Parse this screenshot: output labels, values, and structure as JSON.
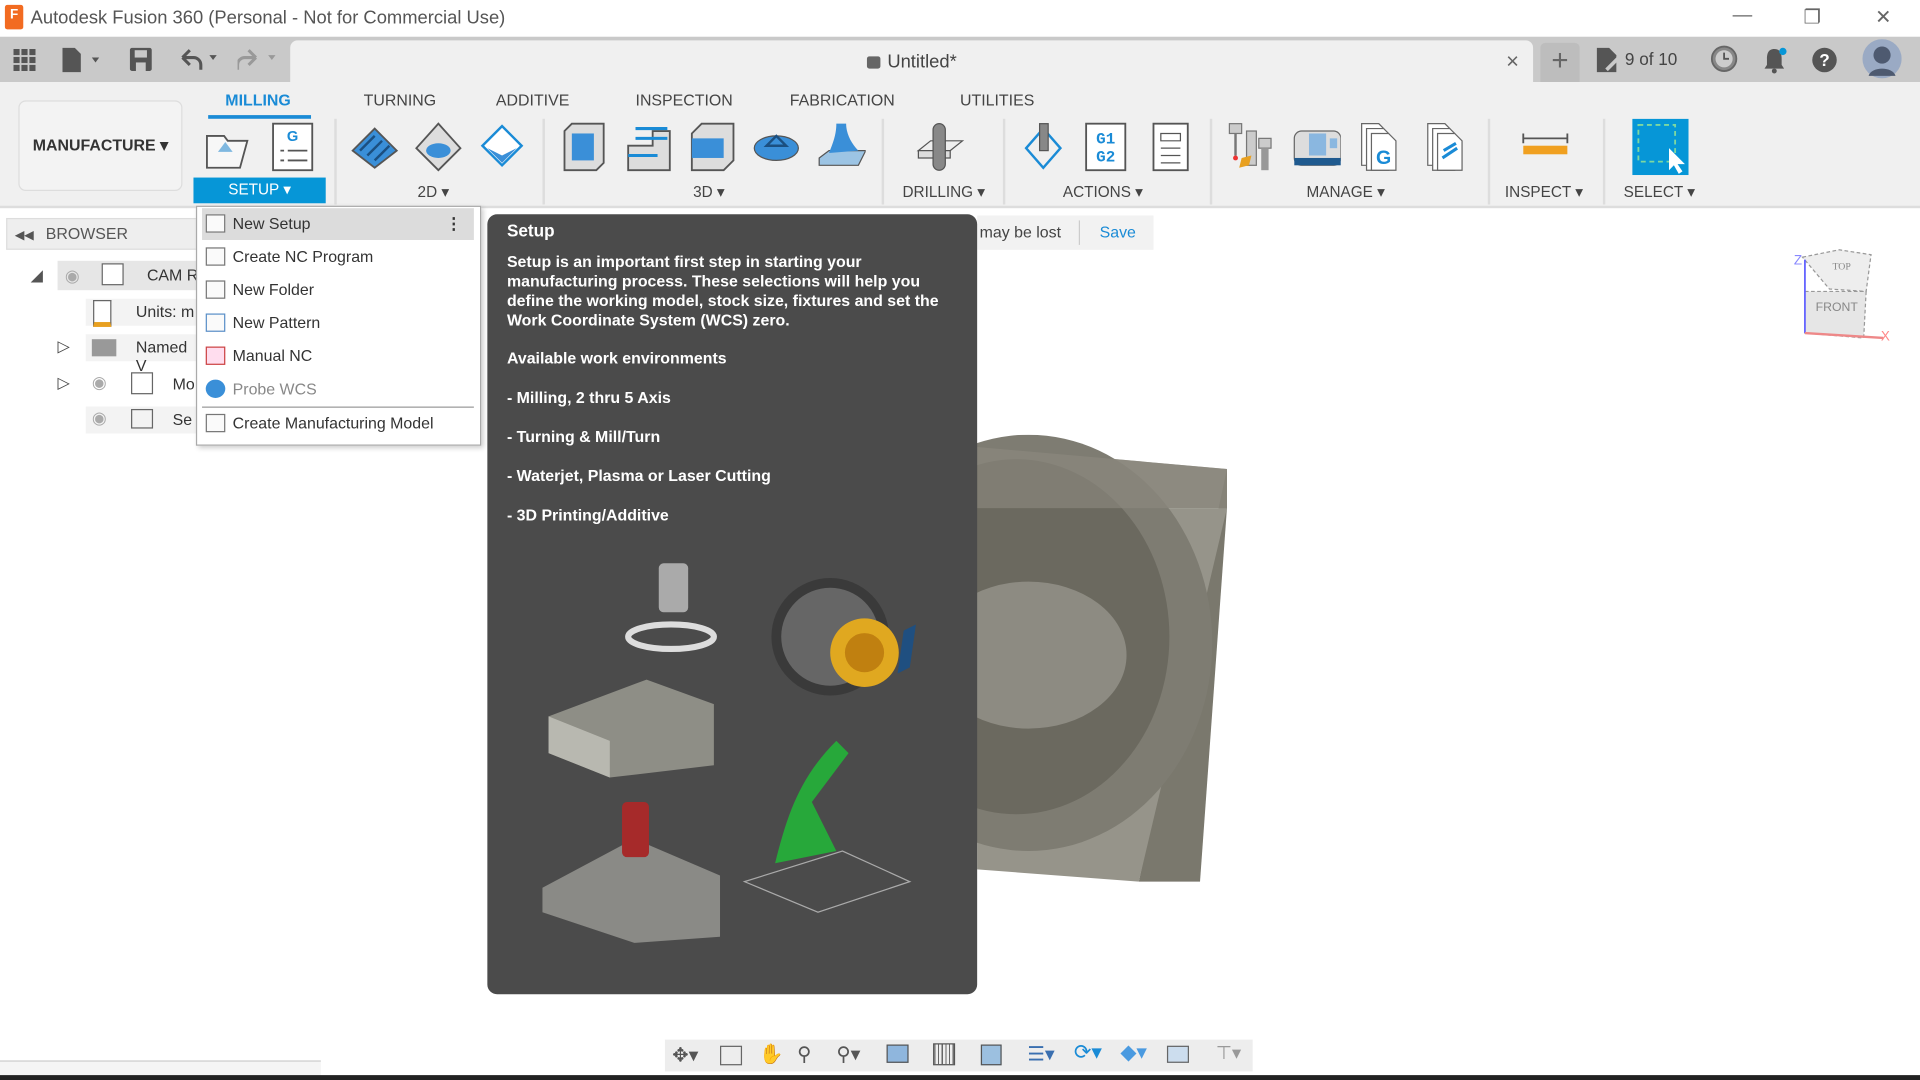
{
  "window": {
    "title": "Autodesk Fusion 360 (Personal - Not for Commercial Use)",
    "logo_letter": "F",
    "minimize": "—",
    "restore": "❐",
    "close": "✕"
  },
  "tabbar": {
    "doc_title": "Untitled*",
    "close": "×",
    "new_tab": "+",
    "version": "9 of 10"
  },
  "ribbon": {
    "workspace": "MANUFACTURE ▾",
    "tabs": [
      "MILLING",
      "TURNING",
      "ADDITIVE",
      "INSPECTION",
      "FABRICATION",
      "UTILITIES"
    ],
    "groups": [
      "SETUP ▾",
      "2D ▾",
      "3D ▾",
      "DRILLING ▾",
      "ACTIONS ▾",
      "MANAGE ▾",
      "INSPECT ▾",
      "SELECT ▾"
    ]
  },
  "browser": {
    "title": "BROWSER",
    "items": [
      "CAM R",
      "Units: m",
      "Named V",
      "Mo",
      "Se"
    ]
  },
  "dropdown": {
    "items": [
      "New Setup",
      "Create NC Program",
      "New Folder",
      "New Pattern",
      "Manual NC",
      "Probe WCS",
      "Create Manufacturing Model"
    ],
    "more": "⋮"
  },
  "tooltip": {
    "title": "Setup",
    "body": "Setup is an important first step in starting your manufacturing process. These selections will help you define the working model, stock size, fixtures and set the Work Coordinate System (WCS) zero.",
    "heading": "Available work environments",
    "list": [
      "- Milling, 2 thru 5 Axis",
      "- Turning & Mill/Turn",
      "- Waterjet, Plasma or Laser Cutting",
      "- 3D Printing/Additive"
    ]
  },
  "notification": {
    "text": "may be lost",
    "save": "Save"
  },
  "viewcube": {
    "top": "TOP",
    "front": "FRONT",
    "z": "Z",
    "x": "X"
  },
  "colors": {
    "accent": "#0696d7",
    "tooltip_bg": "#4b4b4b"
  }
}
